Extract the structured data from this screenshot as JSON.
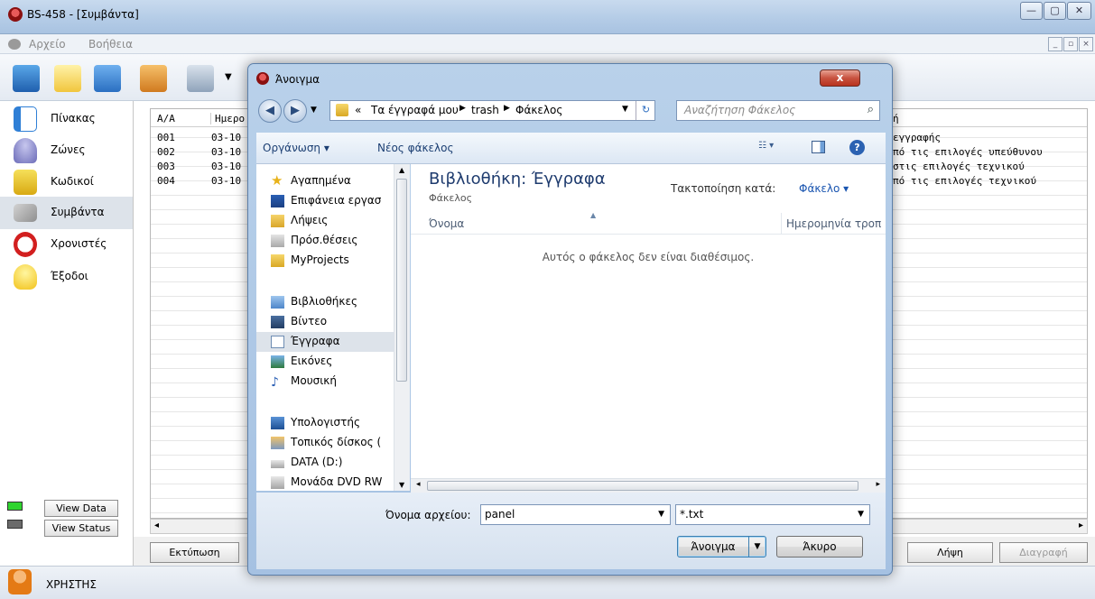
{
  "app": {
    "title": "BS-458 - [Συμβάντα]",
    "menu": [
      "Αρχείο",
      "Βοήθεια"
    ],
    "window_controls": [
      "—",
      "▢",
      "✕"
    ],
    "mdi_controls": [
      "_",
      "▫",
      "×"
    ]
  },
  "sidebar": {
    "items": [
      {
        "label": "Πίνακας",
        "icon": "table-icon"
      },
      {
        "label": "Ζώνες",
        "icon": "bell-icon"
      },
      {
        "label": "Κωδικοί",
        "icon": "padlock-icon"
      },
      {
        "label": "Συμβάντα",
        "icon": "events-icon"
      },
      {
        "label": "Χρονιστές",
        "icon": "alarm-clock-icon"
      },
      {
        "label": "Έξοδοι",
        "icon": "light-bulb-icon"
      }
    ],
    "view_data": "View Data",
    "view_status": "View Status"
  },
  "grid": {
    "headers": [
      "A/A",
      "Ημερο",
      "ή"
    ],
    "rows": [
      {
        "id": "001",
        "date": "03-10",
        "desc": "εγγραφής"
      },
      {
        "id": "002",
        "date": "03-10",
        "desc": "πό τις επιλογές υπεύθυνου"
      },
      {
        "id": "003",
        "date": "03-10",
        "desc": "στις επιλογές τεχνικού"
      },
      {
        "id": "004",
        "date": "03-10",
        "desc": "πό τις επιλογές τεχνικού"
      }
    ]
  },
  "bottom": {
    "print": "Εκτύπωση",
    "receive": "Λήψη",
    "delete": "Διαγραφή"
  },
  "status": {
    "user": "ΧΡΗΣΤΗΣ"
  },
  "dialog": {
    "title": "Άνοιγμα",
    "close": "x",
    "breadcrumb": [
      "«",
      "Τα έγγραφά μου",
      "trash",
      "Φάκελος"
    ],
    "search_placeholder": "Αναζήτηση Φάκελος",
    "organize": "Οργάνωση ▾",
    "new_folder": "Νέος φάκελος",
    "nav": {
      "favorites_header": "Αγαπημένα",
      "favorites": [
        {
          "label": "Επιφάνεια εργασ",
          "icon": "desktop-icon"
        },
        {
          "label": "Λήψεις",
          "icon": "downloads-icon"
        },
        {
          "label": "Πρόσ.θέσεις",
          "icon": "recent-places-icon"
        },
        {
          "label": "MyProjects",
          "icon": "folder-icon"
        }
      ],
      "libraries_header": "Βιβλιοθήκες",
      "libraries": [
        {
          "label": "Βίντεο",
          "icon": "video-icon"
        },
        {
          "label": "Έγγραφα",
          "icon": "document-icon"
        },
        {
          "label": "Εικόνες",
          "icon": "pictures-icon"
        },
        {
          "label": "Μουσική",
          "icon": "music-icon"
        }
      ],
      "computer_header": "Υπολογιστής",
      "computer": [
        {
          "label": "Τοπικός δίσκος (",
          "icon": "local-disk-icon"
        },
        {
          "label": "DATA (D:)",
          "icon": "drive-icon"
        },
        {
          "label": "Μονάδα DVD RW",
          "icon": "dvd-icon"
        }
      ]
    },
    "library_title": "Βιβλιοθήκη: Έγγραφα",
    "library_subtitle": "Φάκελος",
    "arrange_label": "Τακτοποίηση κατά:",
    "arrange_value": "Φάκελο ▾",
    "col_name": "Όνομα",
    "col_date": "Ημερομηνία τροπ",
    "empty_message": "Αυτός ο φάκελος δεν είναι διαθέσιμος.",
    "filename_label": "Όνομα αρχείου:",
    "filename_value": "panel",
    "filter_value": "*.txt",
    "open": "Άνοιγμα",
    "cancel": "Άκυρο"
  }
}
